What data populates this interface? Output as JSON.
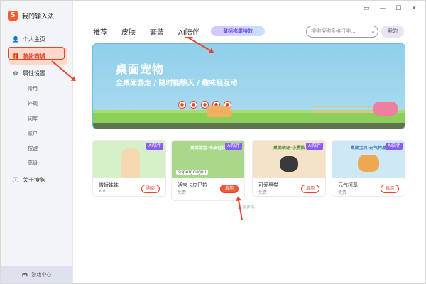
{
  "sidebar": {
    "brand": "我的输入法",
    "items": [
      {
        "label": "个人主页",
        "icon": "person-icon"
      },
      {
        "label": "装扮商城",
        "icon": "shop-icon"
      },
      {
        "label": "属性设置",
        "icon": "gear-icon"
      }
    ],
    "sub_items": [
      "常用",
      "外观",
      "词库",
      "账户",
      "按键",
      "高级"
    ],
    "about": "关于搜狗",
    "game_center": "游戏中心"
  },
  "tabs": [
    "推荐",
    "皮肤",
    "套装",
    "AI陪伴"
  ],
  "promo": "鼠标拖尾特效",
  "search": {
    "placeholder": "搜狗搜狗多格打字..."
  },
  "mine_label": "我的",
  "banner": {
    "title": "桌面宠物",
    "subtitle": "全桌面游走 / 随时能聊天 / 趣味轻互动"
  },
  "cards": [
    {
      "img_title": "",
      "name": "傲娇妹妹",
      "price": "¥ 6",
      "button": "购买",
      "tag": "AI陪伴"
    },
    {
      "img_title": "桌面活宝·卡皮巴拉",
      "name": "活宝卡皮巴拉",
      "price": "免费",
      "button": "启用",
      "tag": "AI陪伴",
      "badge": "supergougou"
    },
    {
      "img_title": "桌面萌宠·小黑猫",
      "name": "可爱黑猫",
      "price": "免费",
      "button": "启用",
      "tag": "AI陪伴"
    },
    {
      "img_title": "桌面宝贝·元气柯基",
      "name": "元气柯基",
      "price": "免费",
      "button": "启用",
      "tag": "AI陪伴"
    }
  ],
  "no_more": "没有更多",
  "colors": {
    "accent": "#e8442b",
    "ai_tag": "#8a5cf5"
  }
}
